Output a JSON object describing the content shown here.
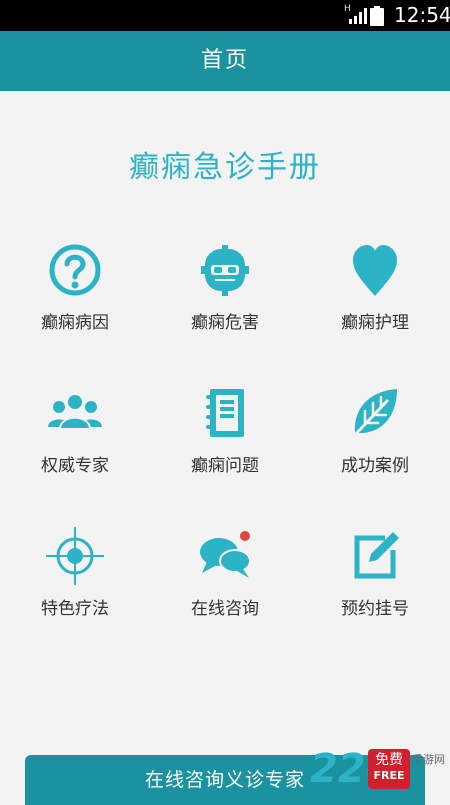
{
  "status_bar": {
    "network": "H",
    "time": "12:54"
  },
  "header": {
    "title": "首页"
  },
  "main": {
    "title": "癫痫急诊手册",
    "items": [
      {
        "label": "癫痫病因",
        "icon": "question-circle-icon"
      },
      {
        "label": "癫痫危害",
        "icon": "robot-face-icon"
      },
      {
        "label": "癫痫护理",
        "icon": "heart-icon"
      },
      {
        "label": "权威专家",
        "icon": "people-icon"
      },
      {
        "label": "癫痫问题",
        "icon": "notebook-icon"
      },
      {
        "label": "成功案例",
        "icon": "leaf-icon"
      },
      {
        "label": "特色疗法",
        "icon": "crosshair-icon"
      },
      {
        "label": "在线咨询",
        "icon": "chat-bubbles-icon"
      },
      {
        "label": "预约挂号",
        "icon": "edit-icon"
      }
    ]
  },
  "bottom_button": {
    "label": "在线咨询义诊专家"
  },
  "watermark": {
    "number": "226",
    "badge_top": "免费",
    "badge_bottom": "FREE",
    "site": "手游网"
  },
  "colors": {
    "primary": "#1a929f",
    "accent": "#2db3c6",
    "status_bar": "#000000",
    "background": "#f3f3f3"
  }
}
